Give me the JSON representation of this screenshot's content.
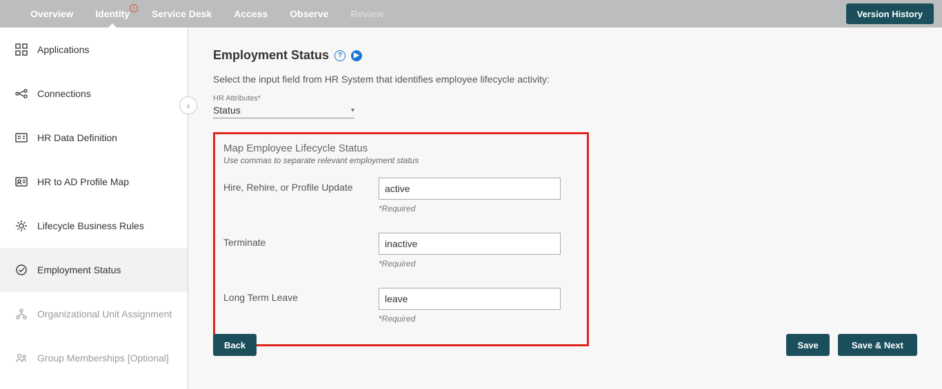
{
  "topbar": {
    "tabs": [
      {
        "label": "Overview"
      },
      {
        "label": "Identity"
      },
      {
        "label": "Service Desk"
      },
      {
        "label": "Access"
      },
      {
        "label": "Observe"
      },
      {
        "label": "Review"
      }
    ],
    "version_history": "Version History"
  },
  "sidebar": {
    "items": [
      {
        "label": "Applications"
      },
      {
        "label": "Connections"
      },
      {
        "label": "HR Data Definition"
      },
      {
        "label": "HR to AD Profile Map"
      },
      {
        "label": "Lifecycle Business Rules"
      },
      {
        "label": "Employment Status"
      },
      {
        "label": "Organizational Unit Assignment"
      },
      {
        "label": "Group Memberships [Optional]"
      }
    ]
  },
  "main": {
    "title": "Employment Status",
    "subtitle": "Select the input field from HR System that identifies employee lifecycle activity:",
    "hr_attr_label": "HR Attributes*",
    "hr_attr_value": "Status",
    "box_title": "Map Employee Lifecycle Status",
    "box_hint": "Use commas to separate relevant employment status",
    "required_note": "*Required",
    "fields": [
      {
        "label": "Hire, Rehire, or Profile Update",
        "value": "active"
      },
      {
        "label": "Terminate",
        "value": "inactive"
      },
      {
        "label": "Long Term Leave",
        "value": "leave"
      }
    ]
  },
  "footer": {
    "back": "Back",
    "save": "Save",
    "save_next": "Save & Next"
  }
}
